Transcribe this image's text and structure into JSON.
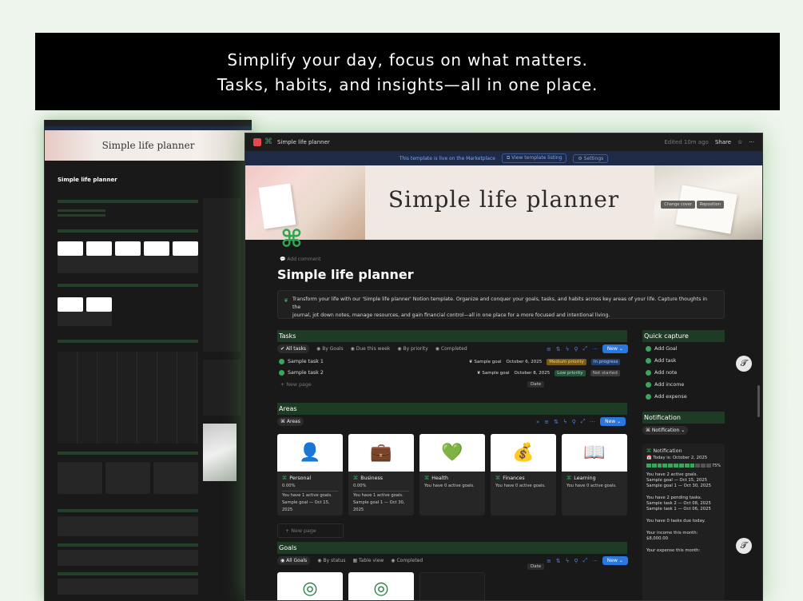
{
  "banner": {
    "line1": "Simplify your day, focus on what matters.",
    "line2": "Tasks, habits, and insights—all in one place."
  },
  "mini": {
    "title": "Simple life planner",
    "cover_title": "Simple life planner"
  },
  "window": {
    "title": "Simple life planner",
    "edited": "Edited 10m ago",
    "share": "Share",
    "info_text": "This template is live on the Marketplace",
    "view_listing": "View template listing",
    "settings": "Settings",
    "cover_title": "Simple life planner",
    "change_cover": "Change cover",
    "reposition": "Reposition",
    "add_comment": "Add comment",
    "page_title": "Simple life planner",
    "callout_line1": "Transform your life with our 'Simple life planner' Notion template. Organize and conquer your goals, tasks, and habits across key areas of your life. Capture thoughts in the",
    "callout_line2": "journal, jot down notes, manage resources, and gain financial control—all in one place for a more focused and intentional living."
  },
  "tasks": {
    "heading": "Tasks",
    "tabs": [
      "All tasks",
      "By Goals",
      "Due this week",
      "By priority",
      "Completed"
    ],
    "new": "New",
    "rows": [
      {
        "name": "Sample task 1",
        "goal": "Sample goal",
        "date": "October 6, 2025",
        "priority": "Medium priority",
        "status": "In progress"
      },
      {
        "name": "Sample task 2",
        "goal": "Sample goal",
        "date": "October 8, 2025",
        "priority": "Low priority",
        "status": "Not started"
      }
    ],
    "new_page": "New page",
    "date_chip": "Date"
  },
  "areas": {
    "heading": "Areas",
    "tab": "Areas",
    "new": "New",
    "cards": [
      {
        "name": "Personal",
        "pct": "0.00%",
        "l1": "You have 1 active goals.",
        "l2": "Sample goal — Oct 15,",
        "l3": "2025"
      },
      {
        "name": "Business",
        "pct": "0.00%",
        "l1": "You have 1 active goals.",
        "l2": "Sample goal 1 — Oct 30,",
        "l3": "2025"
      },
      {
        "name": "Health",
        "pct": "",
        "l1": "You have 0 active goals.",
        "l2": "",
        "l3": ""
      },
      {
        "name": "Finances",
        "pct": "",
        "l1": "You have 0 active goals.",
        "l2": "",
        "l3": ""
      },
      {
        "name": "Learning",
        "pct": "",
        "l1": "You have 0 active goals.",
        "l2": "",
        "l3": ""
      }
    ],
    "new_page": "New page"
  },
  "goals": {
    "heading": "Goals",
    "tabs": [
      "All Goals",
      "By status",
      "Table view",
      "Completed"
    ],
    "new": "New",
    "date_chip": "Date"
  },
  "quick_capture": {
    "heading": "Quick capture",
    "items": [
      "Add Goal",
      "Add task",
      "Add note",
      "Add income",
      "Add expense"
    ]
  },
  "notification": {
    "heading": "Notification",
    "tab": "Notification",
    "card_title": "Notification",
    "today": "Today is: October 2, 2025",
    "progress_label": "75%",
    "g1": "You have 2 active goals.",
    "g2": "Sample goal — Oct 15, 2025",
    "g3": "Sample goal 1 — Oct 30, 2025",
    "t1": "You have 2 pending tasks.",
    "t2": "Sample task 2 — Oct 08, 2025",
    "t3": "Sample task 1 — Oct 06, 2025",
    "t4": "You have 0 tasks due today.",
    "i1": "Your income this month:",
    "i2": "$8,000.00",
    "e1": "Your expense this month:"
  },
  "progress": {
    "filled": 15,
    "total": 20
  }
}
